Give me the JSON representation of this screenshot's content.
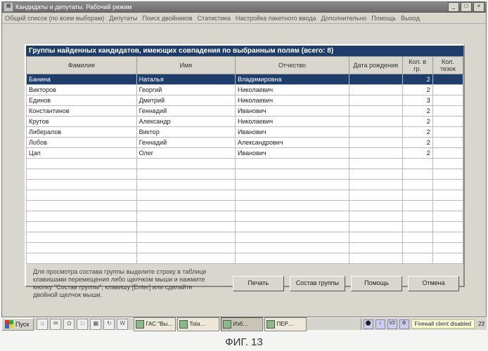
{
  "window": {
    "title": "Кандидаты и депутаты. Рабочий режим"
  },
  "menu": {
    "items": [
      "Общий список (по всем выборам)",
      "Депутаты",
      "Поиск двойников",
      "Статистика",
      "Настройка пакетного ввода",
      "Дополнительно",
      "Помощь",
      "Выход"
    ]
  },
  "dialog": {
    "title": "Группы найденных кандидатов, имеющих совпадения по выбранным полям (всего: 8)",
    "columns": {
      "lastname": "Фамилия",
      "firstname": "Имя",
      "patronymic": "Отчество",
      "dob": "Дата рождения",
      "count_group": "Кол. в гр.",
      "count_tezok": "Кол. тезок"
    },
    "rows": [
      {
        "lastname": "Банина",
        "firstname": "Наталья",
        "patronymic": "Владимировна",
        "dob": "",
        "cg": "2",
        "ct": ""
      },
      {
        "lastname": "Викторов",
        "firstname": "Георгий",
        "patronymic": "Николаевич",
        "dob": "",
        "cg": "2",
        "ct": ""
      },
      {
        "lastname": "Единов",
        "firstname": "Дмитрий",
        "patronymic": "Николаевич",
        "dob": "",
        "cg": "3",
        "ct": ""
      },
      {
        "lastname": "Константинов",
        "firstname": "Геннадий",
        "patronymic": "Иванович",
        "dob": "",
        "cg": "2",
        "ct": ""
      },
      {
        "lastname": "Крутов",
        "firstname": "Александр",
        "patronymic": "Николаевич",
        "dob": "",
        "cg": "2",
        "ct": ""
      },
      {
        "lastname": "Либералов",
        "firstname": "Виктор",
        "patronymic": "Иванович",
        "dob": "",
        "cg": "2",
        "ct": ""
      },
      {
        "lastname": "Лобов",
        "firstname": "Геннадий",
        "patronymic": "Александрович",
        "dob": "",
        "cg": "2",
        "ct": ""
      },
      {
        "lastname": "Цап",
        "firstname": "Олег",
        "patronymic": "Иванович",
        "dob": "",
        "cg": "2",
        "ct": ""
      }
    ],
    "instruction": "Для просмотра состава группы выделите строку в таблице клавишами перемещения либо щелчком мыши и нажмите кнопку \"Состав группы\", клавишу [Enter] или сделайте двойной щелчок мыши.",
    "buttons": {
      "print": "Печать",
      "group_contents": "Состав группы",
      "help": "Помощь",
      "cancel": "Отмена"
    }
  },
  "taskbar": {
    "start": "Пуск",
    "tasks": [
      "ГАС \"Вы…",
      "Tota…",
      "Изб…",
      "ПЕР…"
    ],
    "tray": {
      "firewall": "Firewall client disabled",
      "clock": "23"
    }
  },
  "figure": "ФИГ. 13"
}
